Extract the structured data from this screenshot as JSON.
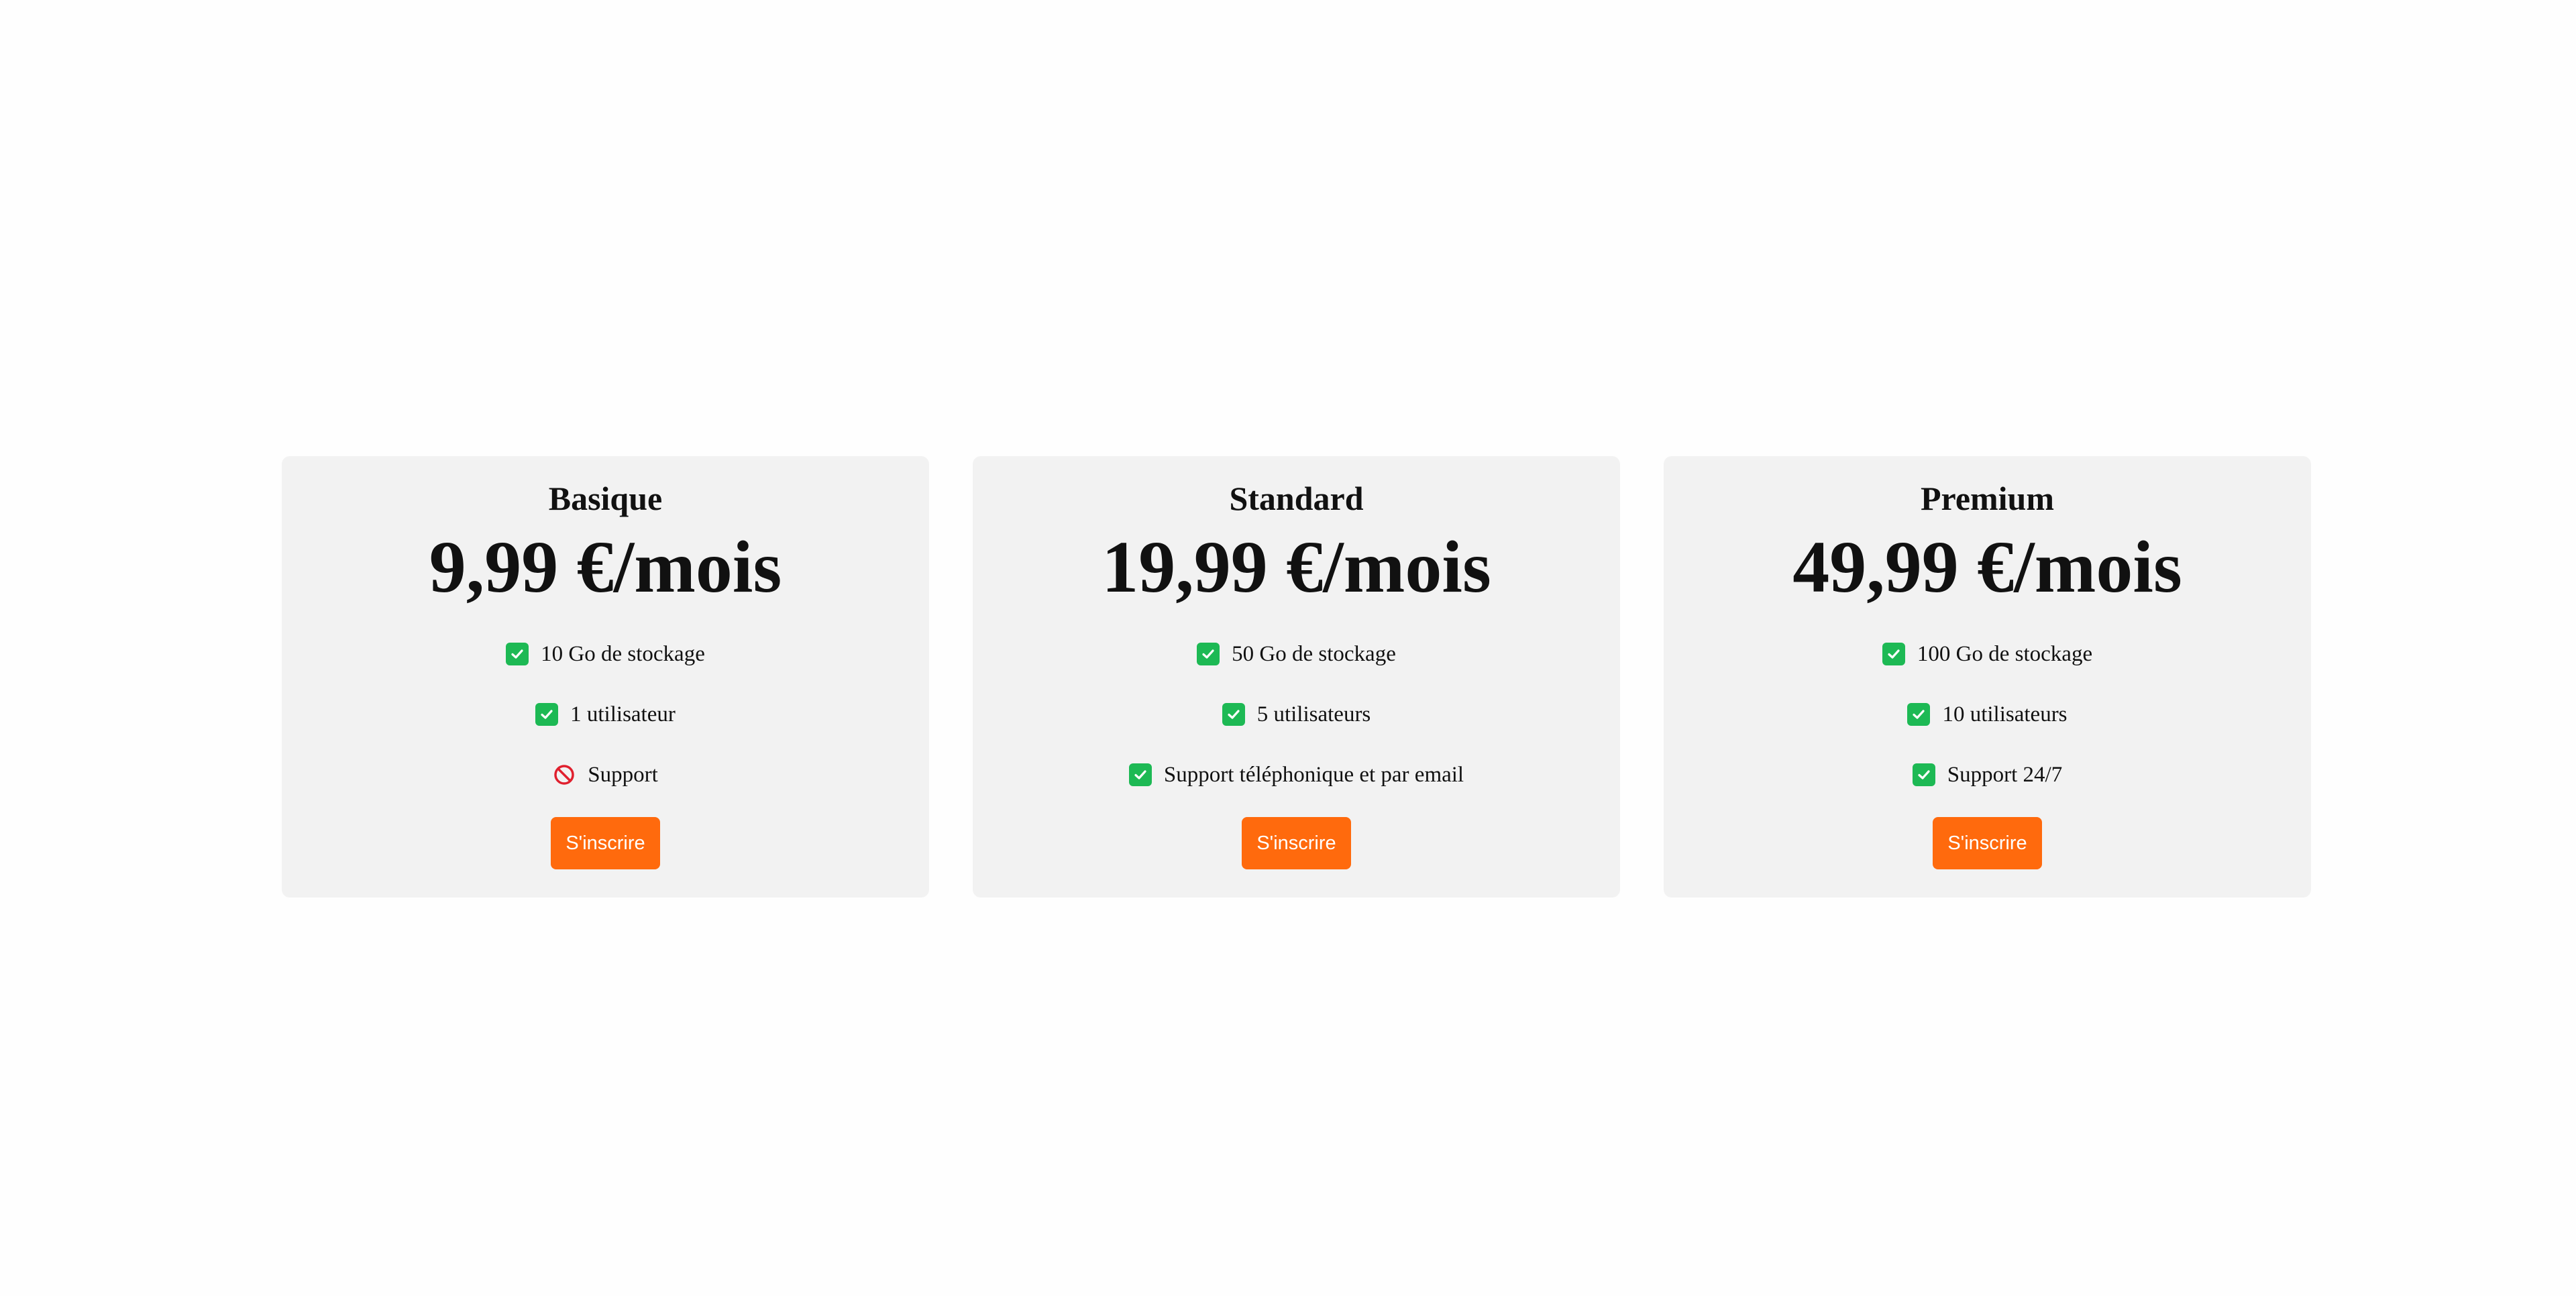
{
  "plans": [
    {
      "name": "Basique",
      "price": "9,99 €/mois",
      "features": [
        {
          "label": "10 Go de stockage",
          "included": true,
          "icon": "check-icon"
        },
        {
          "label": "1 utilisateur",
          "included": true,
          "icon": "check-icon"
        },
        {
          "label": "Support",
          "included": false,
          "icon": "prohibited-icon"
        }
      ],
      "button_label": "S'inscrire"
    },
    {
      "name": "Standard",
      "price": "19,99 €/mois",
      "features": [
        {
          "label": "50 Go de stockage",
          "included": true,
          "icon": "check-icon"
        },
        {
          "label": "5 utilisateurs",
          "included": true,
          "icon": "check-icon"
        },
        {
          "label": "Support téléphonique et par email",
          "included": true,
          "icon": "check-icon"
        }
      ],
      "button_label": "S'inscrire"
    },
    {
      "name": "Premium",
      "price": "49,99 €/mois",
      "features": [
        {
          "label": "100 Go de stockage",
          "included": true,
          "icon": "check-icon"
        },
        {
          "label": "10 utilisateurs",
          "included": true,
          "icon": "check-icon"
        },
        {
          "label": "Support 24/7",
          "included": true,
          "icon": "check-icon"
        }
      ],
      "button_label": "S'inscrire"
    }
  ],
  "colors": {
    "card_background": "#f2f2f2",
    "button_background": "#ff6a0d",
    "button_text": "#ffffff",
    "check_green": "#1db954",
    "prohibited_red": "#e0202e"
  }
}
